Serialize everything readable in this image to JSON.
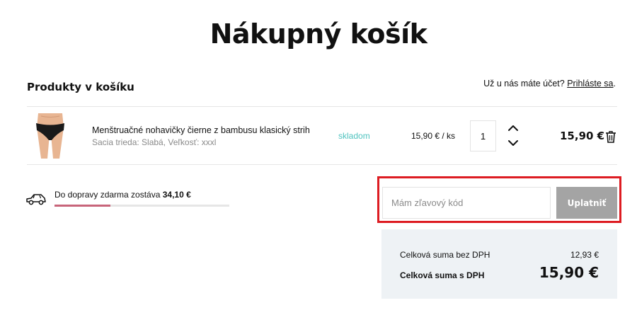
{
  "page": {
    "title": "Nákupný košík"
  },
  "cart": {
    "heading": "Produkty v košíku",
    "login_prompt_text": "Už u nás máte účet?",
    "login_link": "Prihláste sa",
    "login_suffix": "."
  },
  "items": [
    {
      "name": "Menštruačné nohavičky čierne z bambusu klasický strih",
      "meta": "Sacia trieda: Slabá, Veľkosť: xxxl",
      "stock": "skladom",
      "unit_price": "15,90 € / ks",
      "quantity": "1",
      "total": "15,90 €",
      "image_icon": "panties-product-photo",
      "stock_color": "#4fc3bf"
    }
  ],
  "shipping": {
    "text": "Do dopravy zdarma zostáva",
    "amount": "34,10 €",
    "progress_fraction": 0.32,
    "bar_color": "#c8657a",
    "icon": "car-icon"
  },
  "coupon": {
    "placeholder": "Mám zľavový kód",
    "apply_label": "Uplatniť",
    "highlight_color": "#dd1c22"
  },
  "summary": {
    "net_label": "Celková suma bez DPH",
    "net_value": "12,93 €",
    "gross_label": "Celková suma s DPH",
    "gross_value": "15,90 €"
  }
}
